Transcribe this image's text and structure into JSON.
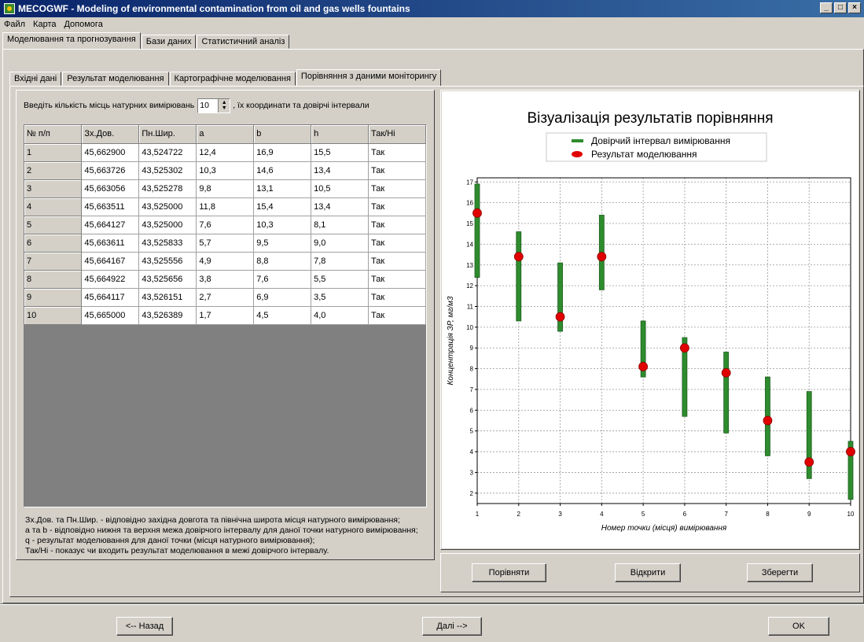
{
  "window": {
    "title": "MECOGWF - Modeling of environmental contamination from oil and gas wells fountains",
    "buttons": {
      "minimize": "_",
      "maximize": "□",
      "close": "×"
    }
  },
  "menu": [
    "Файл",
    "Карта",
    "Допомога"
  ],
  "main_tabs": [
    {
      "label": "Моделювання та прогнозування",
      "active": true
    },
    {
      "label": "Бази даних",
      "active": false
    },
    {
      "label": "Статистичний аналіз",
      "active": false
    }
  ],
  "sub_tabs": [
    {
      "label": "Вхідні дані",
      "active": false
    },
    {
      "label": "Результат моделювання",
      "active": false
    },
    {
      "label": "Картографічне моделювання",
      "active": false
    },
    {
      "label": "Порівняння з даними моніторингу",
      "active": true
    }
  ],
  "left": {
    "prompt_before": "Введіть кількість місць натурних вимірювань",
    "count_value": "10",
    "prompt_after": ", їх координати та довірчі інтервали",
    "columns": [
      "№ п/п",
      "Зх.Дов.",
      "Пн.Шир.",
      "a",
      "b",
      "h",
      "Так/Ні"
    ],
    "rows": [
      [
        "1",
        "45,662900",
        "43,524722",
        "12,4",
        "16,9",
        "15,5",
        "Так"
      ],
      [
        "2",
        "45,663726",
        "43,525302",
        "10,3",
        "14,6",
        "13,4",
        "Так"
      ],
      [
        "3",
        "45,663056",
        "43,525278",
        "9,8",
        "13,1",
        "10,5",
        "Так"
      ],
      [
        "4",
        "45,663511",
        "43,525000",
        "11,8",
        "15,4",
        "13,4",
        "Так"
      ],
      [
        "5",
        "45,664127",
        "43,525000",
        "7,6",
        "10,3",
        "8,1",
        "Так"
      ],
      [
        "6",
        "45,663611",
        "43,525833",
        "5,7",
        "9,5",
        "9,0",
        "Так"
      ],
      [
        "7",
        "45,664167",
        "43,525556",
        "4,9",
        "8,8",
        "7,8",
        "Так"
      ],
      [
        "8",
        "45,664922",
        "43,525656",
        "3,8",
        "7,6",
        "5,5",
        "Так"
      ],
      [
        "9",
        "45,664117",
        "43,526151",
        "2,7",
        "6,9",
        "3,5",
        "Так"
      ],
      [
        "10",
        "45,665000",
        "43,526389",
        "1,7",
        "4,5",
        "4,0",
        "Так"
      ]
    ],
    "notes": [
      "Зх.Дов. та Пн.Шир. - відповідно західна довгота та північна широта місця натурного вимірювання;",
      "a та b - відповідно нижня та верхня межа довірчого інтервалу для даної точки натурного вимірювання;",
      "q - результат моделювання для даної точки (місця натурного вимірювання);",
      "Так/Ні - показує чи входить результат моделювання в межі довірчого інтервалу."
    ]
  },
  "chart_data": {
    "type": "scatter",
    "title": "Візуалізація результатів порівняння",
    "xlabel": "Номер точки (місця) вимірювання",
    "ylabel": "Концентрація ЗР, мг/м3",
    "x": [
      1,
      2,
      3,
      4,
      5,
      6,
      7,
      8,
      9,
      10
    ],
    "xlim": [
      1,
      10
    ],
    "ylim": [
      1.5,
      17.2
    ],
    "yticks": [
      2,
      3,
      4,
      5,
      6,
      7,
      8,
      9,
      10,
      11,
      12,
      13,
      14,
      15,
      16,
      17
    ],
    "grid": true,
    "legend_position": "top-center",
    "series": [
      {
        "name": "Довірчий інтервал вимірювання",
        "kind": "interval",
        "color": "#2e8b2e",
        "low": [
          12.4,
          10.3,
          9.8,
          11.8,
          7.6,
          5.7,
          4.9,
          3.8,
          2.7,
          1.7
        ],
        "high": [
          16.9,
          14.6,
          13.1,
          15.4,
          10.3,
          9.5,
          8.8,
          7.6,
          6.9,
          4.5
        ]
      },
      {
        "name": "Результат моделювання",
        "kind": "point",
        "color": "#e00000",
        "values": [
          15.5,
          13.4,
          10.5,
          13.4,
          8.1,
          9.0,
          7.8,
          5.5,
          3.5,
          4.0
        ]
      }
    ]
  },
  "right_buttons": {
    "compare": "Порівняти",
    "open": "Відкрити",
    "save": "Зберегти"
  },
  "footer": {
    "back": "<-- Назад",
    "next": "Далі -->",
    "ok": "OK"
  }
}
